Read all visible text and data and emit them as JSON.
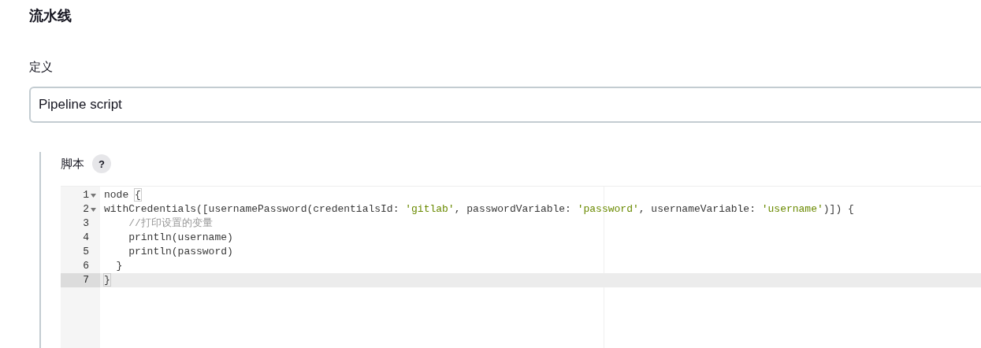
{
  "section_title": "流水线",
  "definition": {
    "label": "定义",
    "value": "Pipeline script"
  },
  "script": {
    "label": "脚本",
    "help": "?",
    "lines": [
      {
        "number": "1",
        "foldable": true,
        "active": false,
        "cursor": false,
        "tokens": [
          {
            "kind": "plain",
            "text": "node "
          },
          {
            "kind": "match",
            "text": "{"
          }
        ]
      },
      {
        "number": "2",
        "foldable": true,
        "active": false,
        "cursor": false,
        "tokens": [
          {
            "kind": "plain",
            "text": "withCredentials([usernamePassword(credentialsId: "
          },
          {
            "kind": "string",
            "text": "'gitlab'"
          },
          {
            "kind": "plain",
            "text": ", passwordVariable: "
          },
          {
            "kind": "string",
            "text": "'password'"
          },
          {
            "kind": "plain",
            "text": ", usernameVariable: "
          },
          {
            "kind": "string",
            "text": "'username'"
          },
          {
            "kind": "plain",
            "text": ")]) {"
          }
        ]
      },
      {
        "number": "3",
        "foldable": false,
        "active": false,
        "cursor": false,
        "tokens": [
          {
            "kind": "comment",
            "text": "    //打印设置的变量"
          }
        ]
      },
      {
        "number": "4",
        "foldable": false,
        "active": false,
        "cursor": false,
        "tokens": [
          {
            "kind": "plain",
            "text": "    println(username)"
          }
        ]
      },
      {
        "number": "5",
        "foldable": false,
        "active": false,
        "cursor": false,
        "tokens": [
          {
            "kind": "plain",
            "text": "    println(password)"
          }
        ]
      },
      {
        "number": "6",
        "foldable": false,
        "active": false,
        "cursor": false,
        "tokens": [
          {
            "kind": "plain",
            "text": "  }"
          }
        ]
      },
      {
        "number": "7",
        "foldable": false,
        "active": true,
        "cursor": true,
        "tokens": [
          {
            "kind": "match",
            "text": "}"
          }
        ]
      }
    ]
  }
}
